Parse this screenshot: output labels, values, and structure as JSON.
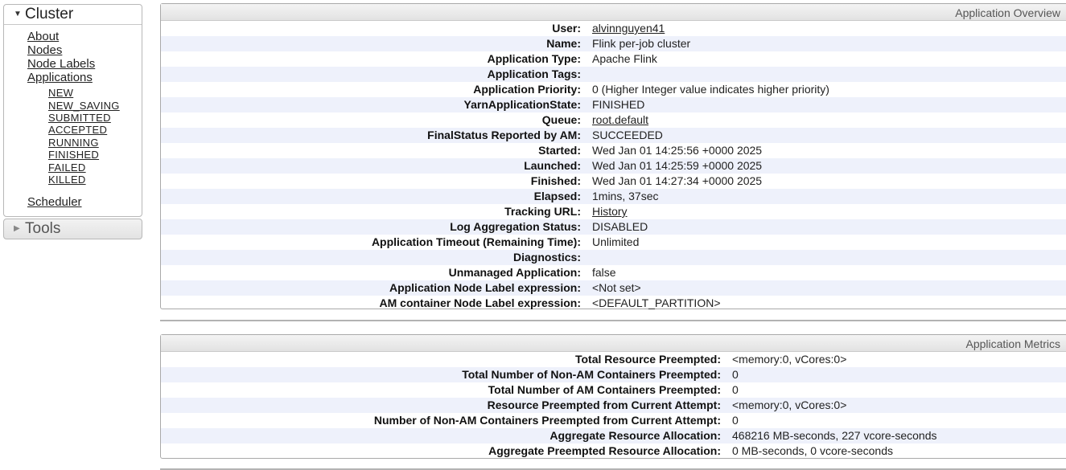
{
  "sidebar": {
    "cluster": {
      "title": "Cluster",
      "links": [
        "About",
        "Nodes",
        "Node Labels",
        "Applications"
      ],
      "app_states": [
        "NEW",
        "NEW_SAVING",
        "SUBMITTED",
        "ACCEPTED",
        "RUNNING",
        "FINISHED",
        "FAILED",
        "KILLED"
      ],
      "scheduler": "Scheduler"
    },
    "tools": {
      "title": "Tools"
    }
  },
  "overview": {
    "header": "Application Overview",
    "rows": [
      {
        "label": "User:",
        "value": "alvinnguyen41",
        "link": true
      },
      {
        "label": "Name:",
        "value": "Flink per-job cluster"
      },
      {
        "label": "Application Type:",
        "value": "Apache Flink"
      },
      {
        "label": "Application Tags:",
        "value": ""
      },
      {
        "label": "Application Priority:",
        "value": "0 (Higher Integer value indicates higher priority)"
      },
      {
        "label": "YarnApplicationState:",
        "value": "FINISHED"
      },
      {
        "label": "Queue:",
        "value": "root.default",
        "link": true
      },
      {
        "label": "FinalStatus Reported by AM:",
        "value": "SUCCEEDED"
      },
      {
        "label": "Started:",
        "value": "Wed Jan 01 14:25:56 +0000 2025"
      },
      {
        "label": "Launched:",
        "value": "Wed Jan 01 14:25:59 +0000 2025"
      },
      {
        "label": "Finished:",
        "value": "Wed Jan 01 14:27:34 +0000 2025"
      },
      {
        "label": "Elapsed:",
        "value": "1mins, 37sec"
      },
      {
        "label": "Tracking URL:",
        "value": "History",
        "link": true
      },
      {
        "label": "Log Aggregation Status:",
        "value": "DISABLED"
      },
      {
        "label": "Application Timeout (Remaining Time):",
        "value": "Unlimited"
      },
      {
        "label": "Diagnostics:",
        "value": ""
      },
      {
        "label": "Unmanaged Application:",
        "value": "false"
      },
      {
        "label": "Application Node Label expression:",
        "value": "<Not set>"
      },
      {
        "label": "AM container Node Label expression:",
        "value": "<DEFAULT_PARTITION>"
      }
    ]
  },
  "metrics": {
    "header": "Application Metrics",
    "rows": [
      {
        "label": "Total Resource Preempted:",
        "value": "<memory:0, vCores:0>"
      },
      {
        "label": "Total Number of Non-AM Containers Preempted:",
        "value": "0"
      },
      {
        "label": "Total Number of AM Containers Preempted:",
        "value": "0"
      },
      {
        "label": "Resource Preempted from Current Attempt:",
        "value": "<memory:0, vCores:0>"
      },
      {
        "label": "Number of Non-AM Containers Preempted from Current Attempt:",
        "value": "0"
      },
      {
        "label": "Aggregate Resource Allocation:",
        "value": "468216 MB-seconds, 227 vcore-seconds"
      },
      {
        "label": "Aggregate Preempted Resource Allocation:",
        "value": "0 MB-seconds, 0 vcore-seconds"
      }
    ]
  }
}
